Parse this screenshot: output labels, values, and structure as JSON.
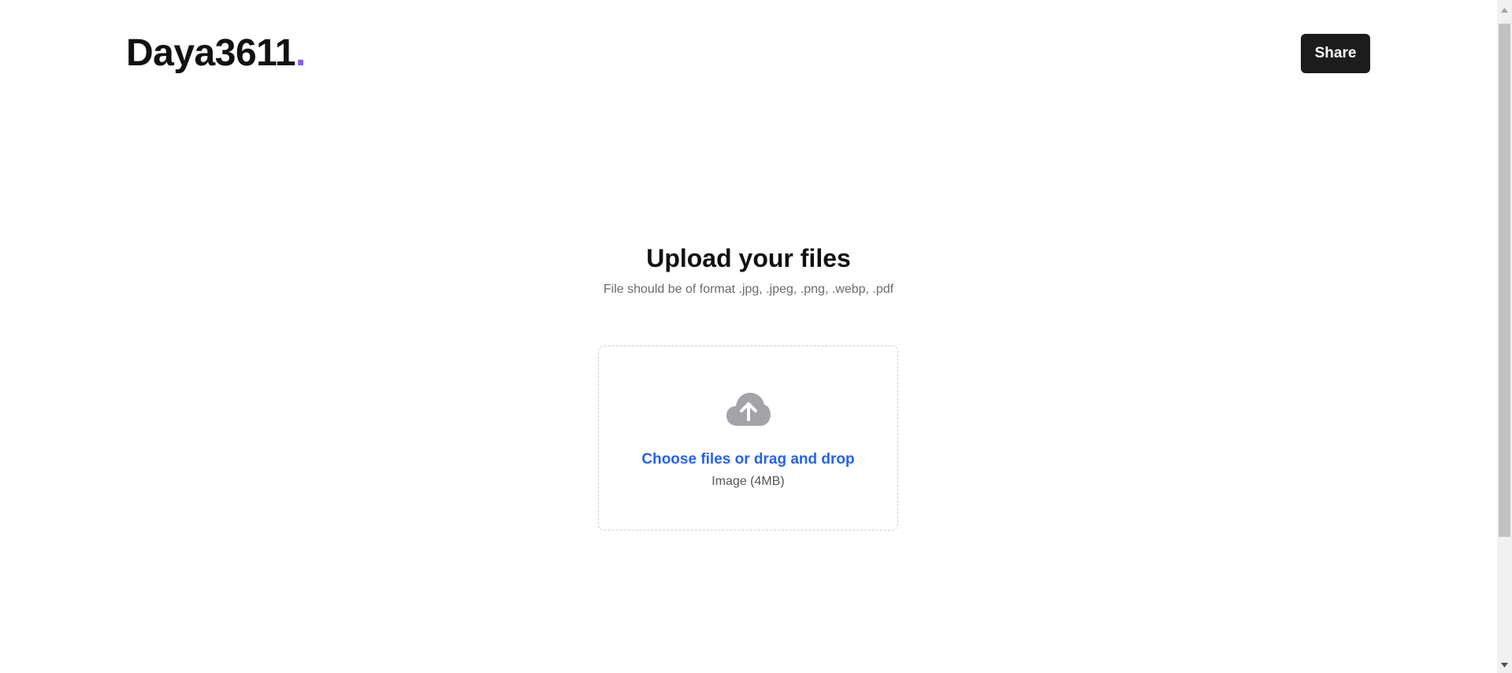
{
  "header": {
    "logo_text": "Daya3611",
    "logo_dot": ".",
    "share_label": "Share"
  },
  "main": {
    "title": "Upload your files",
    "subtitle": "File should be of format .jpg, .jpeg, .png, .webp, .pdf"
  },
  "dropzone": {
    "icon": "cloud-upload-icon",
    "choose_label": "Choose files or drag and drop",
    "hint": "Image (4MB)"
  },
  "colors": {
    "accent_dot": "#8b5cf6",
    "link": "#2563eb",
    "button_bg": "#1c1c1c"
  }
}
